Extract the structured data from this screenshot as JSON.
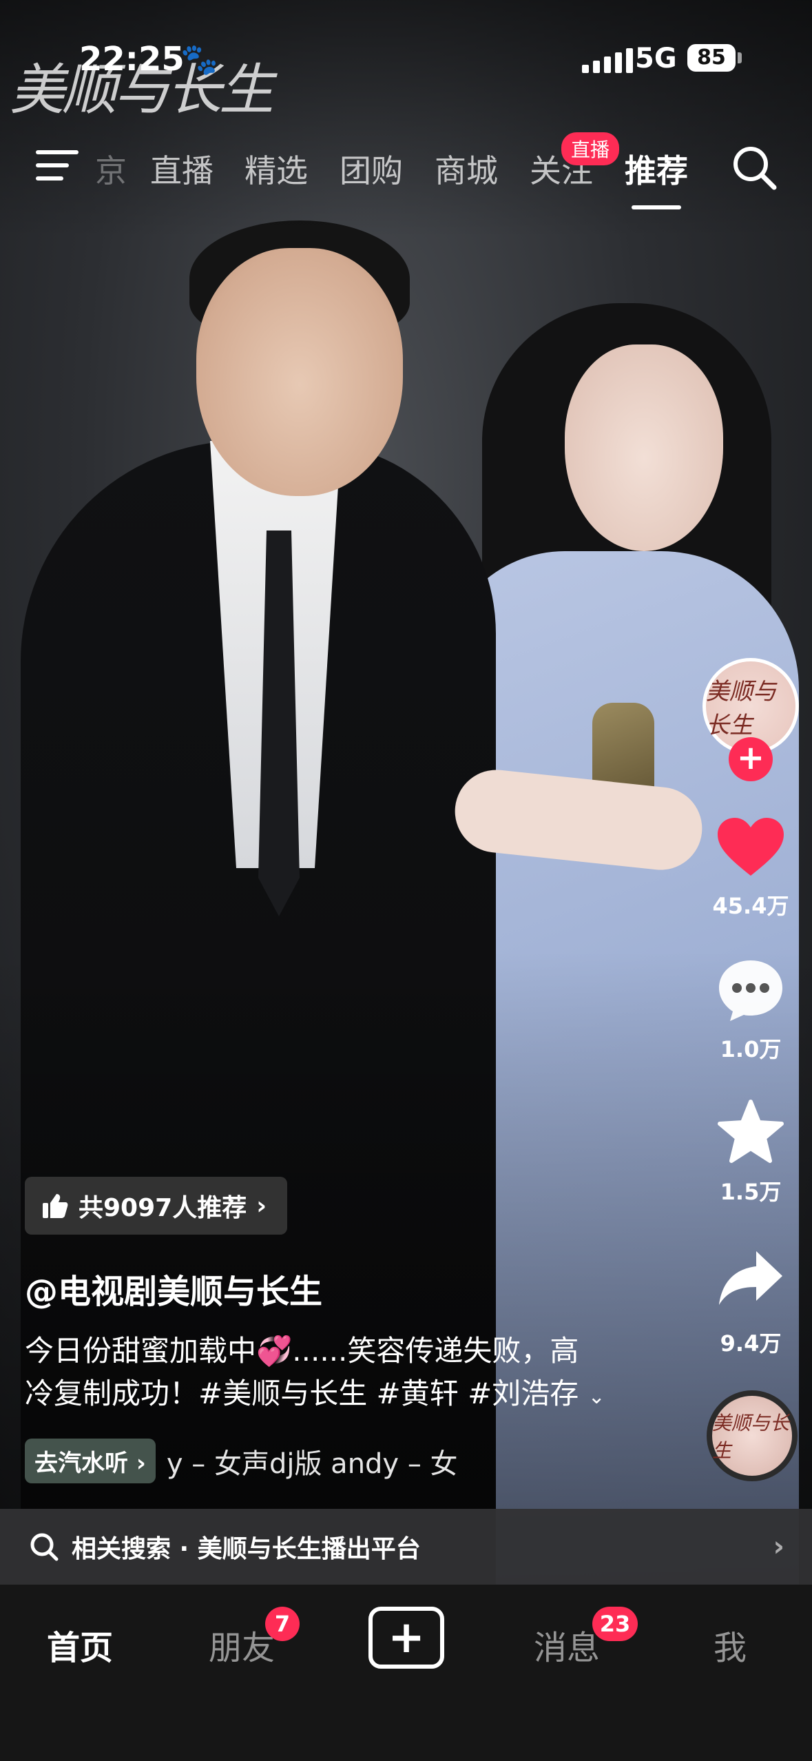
{
  "status": {
    "time": "22:25",
    "network": "5G",
    "battery": "85"
  },
  "watermark": {
    "text": "美顺与长生"
  },
  "tabs": {
    "items": [
      {
        "label": "京"
      },
      {
        "label": "直播"
      },
      {
        "label": "精选"
      },
      {
        "label": "团购"
      },
      {
        "label": "商城"
      },
      {
        "label": "关注"
      },
      {
        "label": "推荐"
      }
    ],
    "active": "推荐",
    "live_badge": "直播"
  },
  "actions": {
    "avatar_text": "美顺与长生",
    "likes": "45.4万",
    "comments": "1.0万",
    "favorites": "1.5万",
    "shares": "9.4万"
  },
  "recommend": {
    "label": "共9097人推荐"
  },
  "post": {
    "author": "@电视剧美顺与长生",
    "caption_line1": "今日份甜蜜加载中💞......笑容传递失败，高",
    "caption_line2": "冷复制成功！#美顺与长生 #黄轩 #刘浩存",
    "soda_label": "去汽水听",
    "music": "y – 女声dj版    andy – 女"
  },
  "related": {
    "label": "相关搜索 · 美顺与长生播出平台"
  },
  "nav": {
    "home": "首页",
    "friends": "朋友",
    "friends_badge": "7",
    "messages": "消息",
    "messages_badge": "23",
    "me": "我"
  },
  "colors": {
    "accent": "#fe2c55",
    "background": "#161616"
  }
}
